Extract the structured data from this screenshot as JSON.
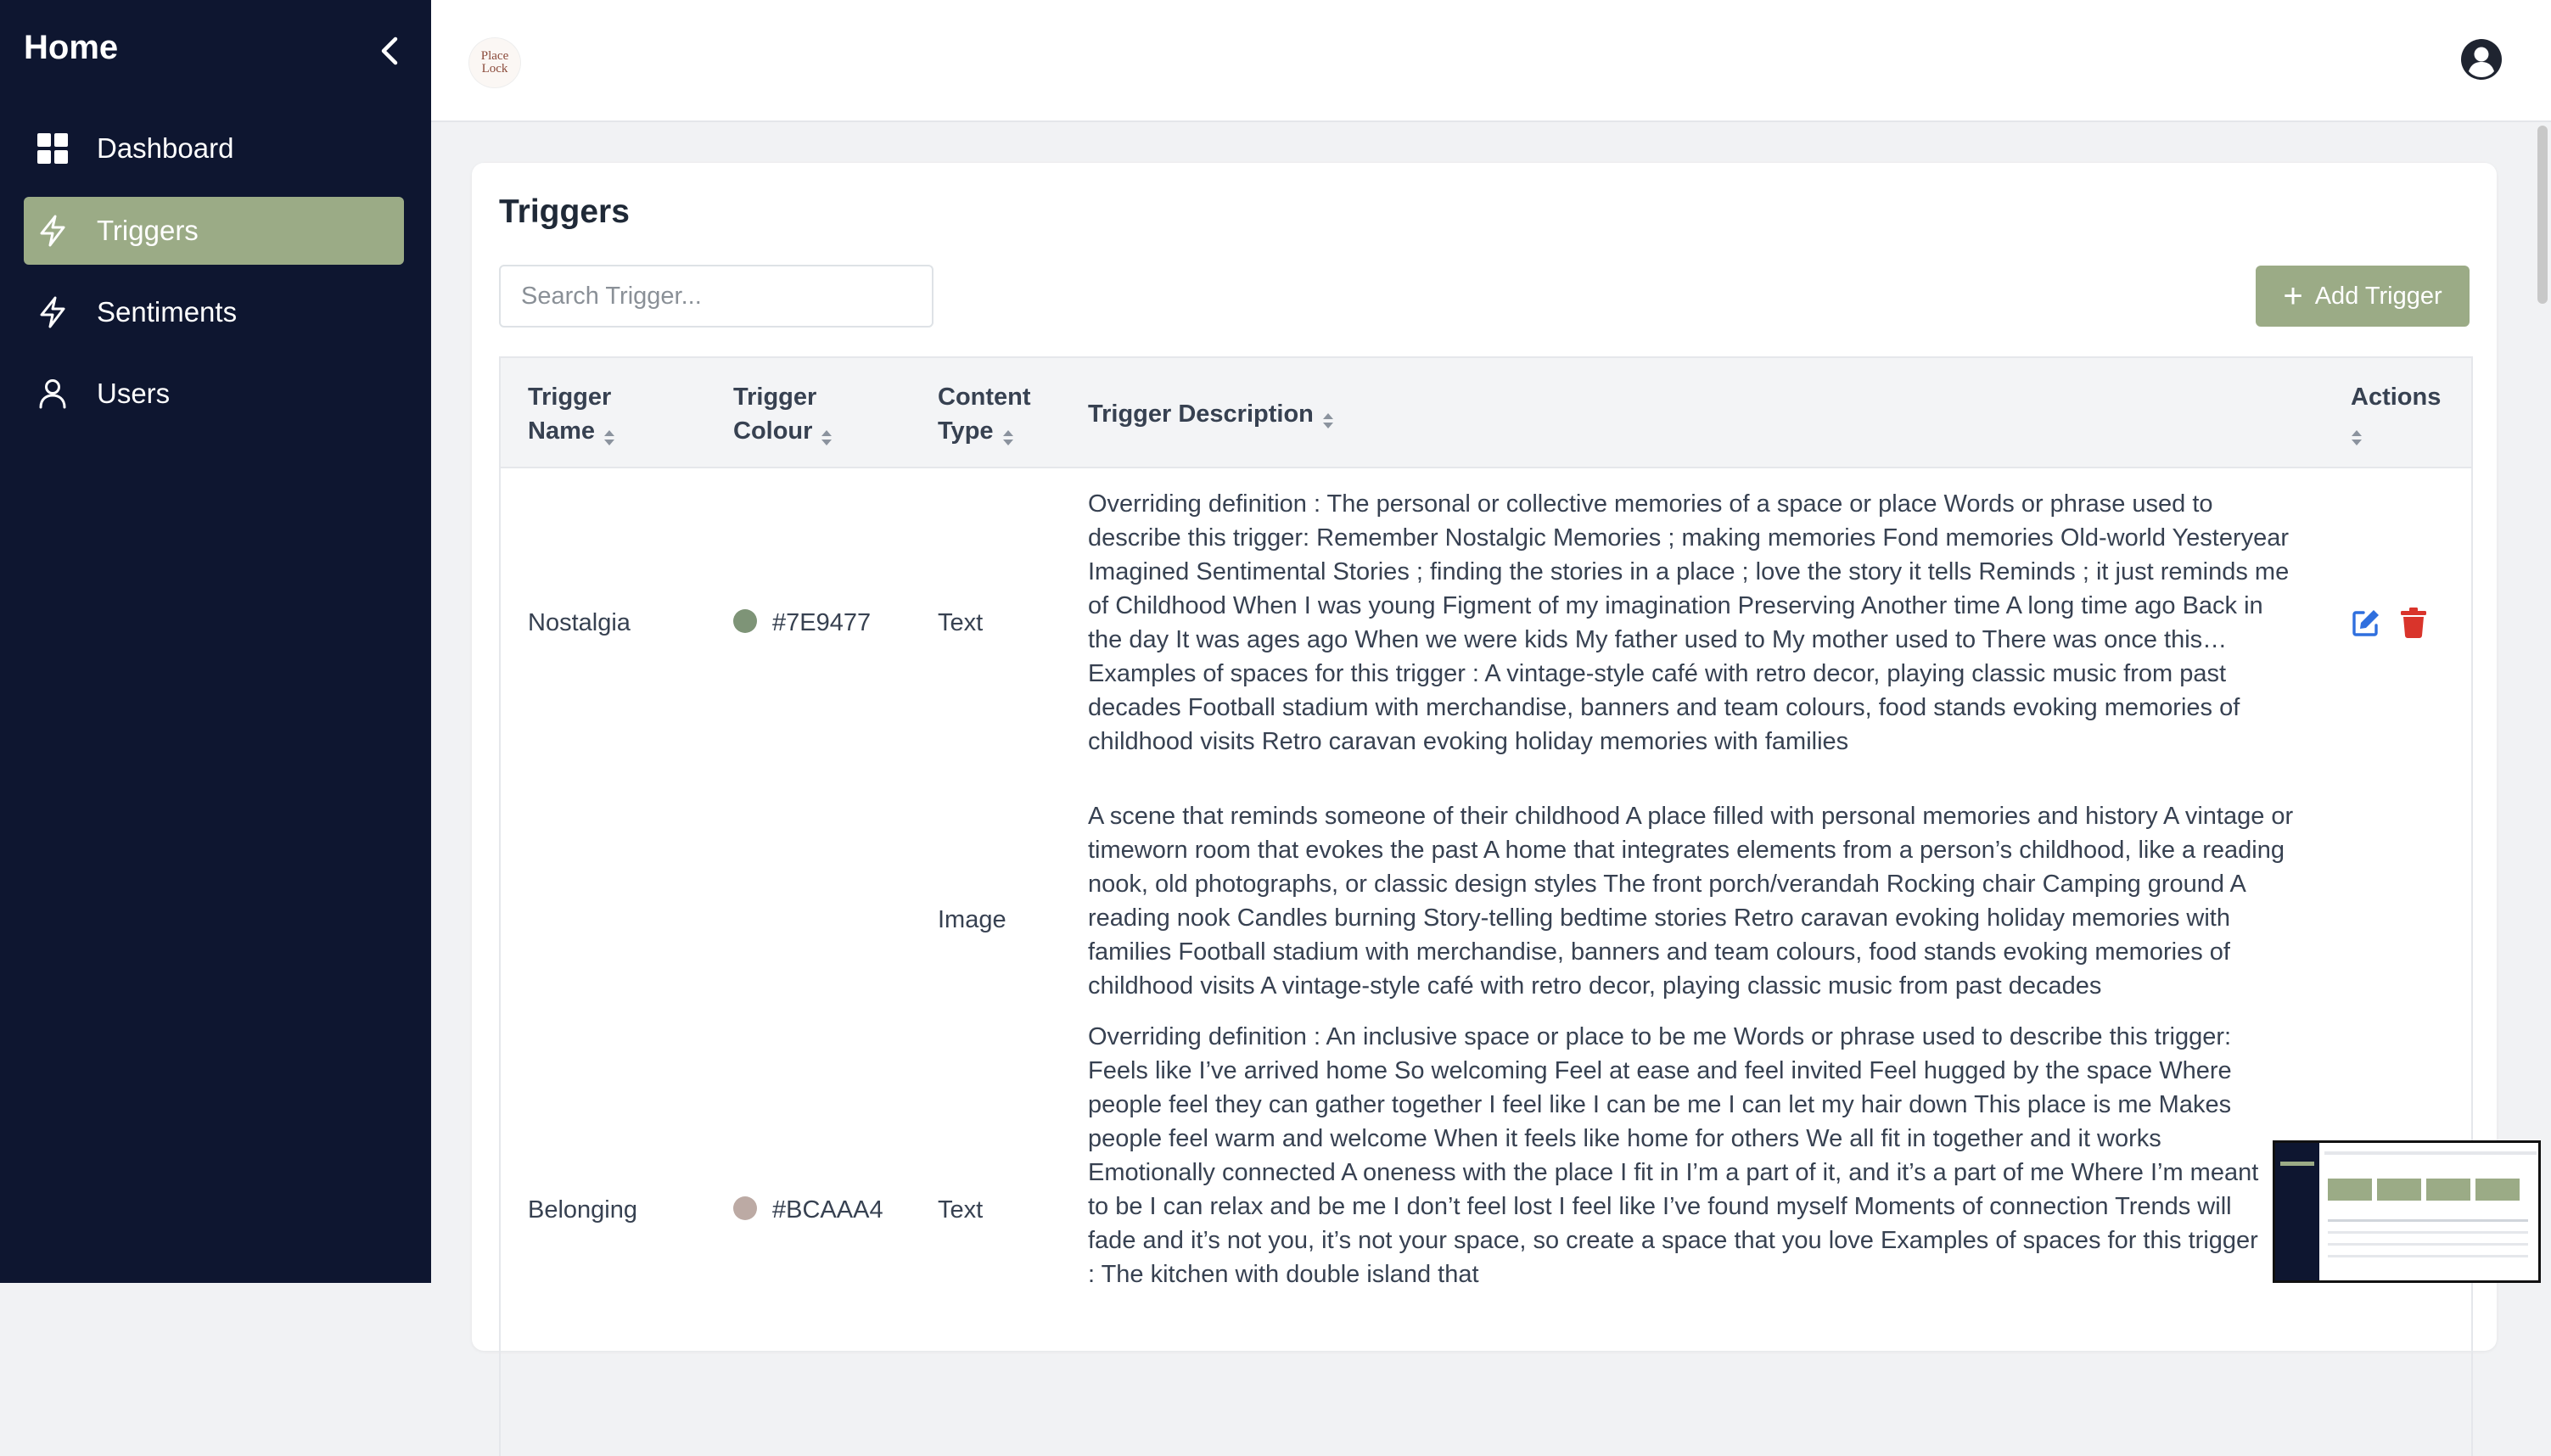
{
  "sidebar": {
    "title": "Home",
    "items": [
      {
        "label": "Dashboard",
        "icon": "dashboard-icon"
      },
      {
        "label": "Triggers",
        "icon": "bolt-icon"
      },
      {
        "label": "Sentiments",
        "icon": "bolt-icon"
      },
      {
        "label": "Users",
        "icon": "user-icon"
      }
    ]
  },
  "header": {
    "logo_line1": "Place",
    "logo_line2": "Lock"
  },
  "page": {
    "title": "Triggers",
    "search_placeholder": "Search Trigger...",
    "add_button": "Add Trigger"
  },
  "table": {
    "headers": {
      "name_1": "Trigger",
      "name_2": "Name",
      "colour_1": "Trigger",
      "colour_2": "Colour",
      "type_1": "Content",
      "type_2": "Type",
      "description": "Trigger Description",
      "actions": "Actions"
    },
    "rows": [
      {
        "name": "Nostalgia",
        "colour": "#7E9477",
        "items": [
          {
            "type": "Text",
            "description": "Overriding definition : The personal or collective memories of a space or place Words or phrase used to describe this trigger: Remember Nostalgic Memories ; making memories Fond memories Old-world Yesteryear Imagined Sentimental Stories ; finding the stories in a place ; love the story it tells Reminds ; it just reminds me of Childhood When I was young Figment of my imagination Preserving Another time A long time ago Back in the day It was ages ago When we were kids My father used to My mother used to There was once this… Examples of spaces for this trigger : A vintage-style café with retro decor, playing classic music from past decades Football stadium with merchandise, banners and team colours, food stands evoking memories of childhood visits Retro caravan evoking holiday memories with families"
          },
          {
            "type": "Image",
            "description": "A scene that reminds someone of their childhood A place filled with personal memories and history A vintage or timeworn room that evokes the past A home that integrates elements from a person’s childhood, like a reading nook, old photographs, or classic design styles The front porch/verandah Rocking chair Camping ground A reading nook Candles burning Story-telling bedtime stories Retro caravan evoking holiday memories with families Football stadium with merchandise, banners and team colours, food stands evoking memories of childhood visits A vintage-style café with retro decor, playing classic music from past decades"
          }
        ]
      },
      {
        "name": "Belonging",
        "colour": "#BCAAA4",
        "items": [
          {
            "type": "Text",
            "description": "Overriding definition : An inclusive space or place to be me Words or phrase used to describe this trigger: Feels like I’ve arrived home So welcoming Feel at ease and feel invited Feel hugged by the space Where people feel they can gather together I feel like I can be me I can let my hair down This place is me Makes people feel warm and welcome When it feels like home for others We all fit in together and it works Emotionally connected A oneness with the place I fit in I’m a part of it, and it’s a part of me Where I’m meant to be I can relax and be me I don’t feel lost I feel like I’ve found myself Moments of connection Trends will fade and it’s not you, it’s not your space, so create a space that you love Examples of spaces for this trigger : The kitchen with double island that"
          }
        ]
      }
    ]
  },
  "colors": {
    "sidebar_bg": "#0e1630",
    "accent": "#9bab86",
    "edit": "#2f6fde",
    "delete": "#d9342b"
  }
}
